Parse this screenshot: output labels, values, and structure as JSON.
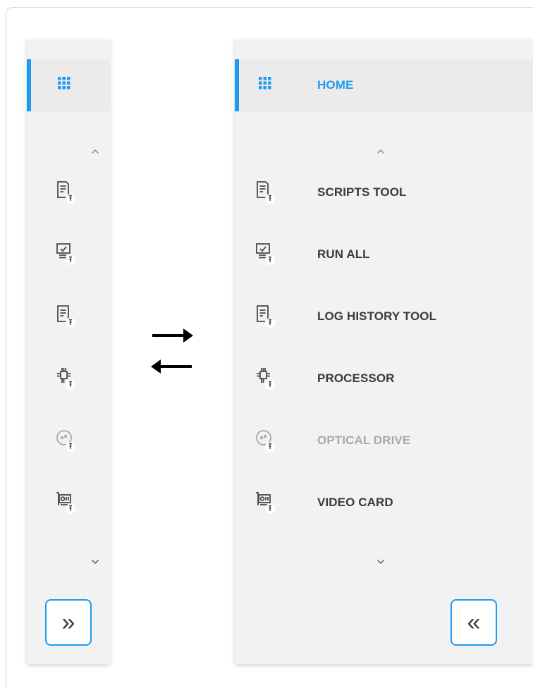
{
  "nav": {
    "home": {
      "label": "HOME",
      "icon": "grid-icon"
    },
    "scroll_up_icon": "chevron-up-icon",
    "scroll_down_icon": "chevron-down-icon",
    "items": [
      {
        "label": "SCRIPTS TOOL",
        "icon": "script-document-pin-icon",
        "disabled": false
      },
      {
        "label": "RUN ALL",
        "icon": "monitor-check-pin-icon",
        "disabled": false
      },
      {
        "label": "LOG HISTORY TOOL",
        "icon": "log-document-pin-icon",
        "disabled": false
      },
      {
        "label": "PROCESSOR",
        "icon": "processor-chip-pin-icon",
        "disabled": false
      },
      {
        "label": "OPTICAL DRIVE",
        "icon": "optical-disc-pin-icon",
        "disabled": true
      },
      {
        "label": "VIDEO CARD",
        "icon": "video-card-pin-icon",
        "disabled": false
      }
    ]
  },
  "collapsed_panel": {
    "toggle_symbol": "»",
    "toggle_icon": "expand-double-chevron-icon"
  },
  "expanded_panel": {
    "toggle_symbol": "«",
    "toggle_icon": "collapse-double-chevron-icon"
  },
  "transition_icon": "swap-arrows-icon",
  "colors": {
    "accent": "#1e9bf0",
    "panel_bg": "#f2f2f2",
    "active_bg": "#ebebeb",
    "text": "#3a3a3a",
    "disabled": "#a9a9a9",
    "icon": "#4a4a4a"
  }
}
